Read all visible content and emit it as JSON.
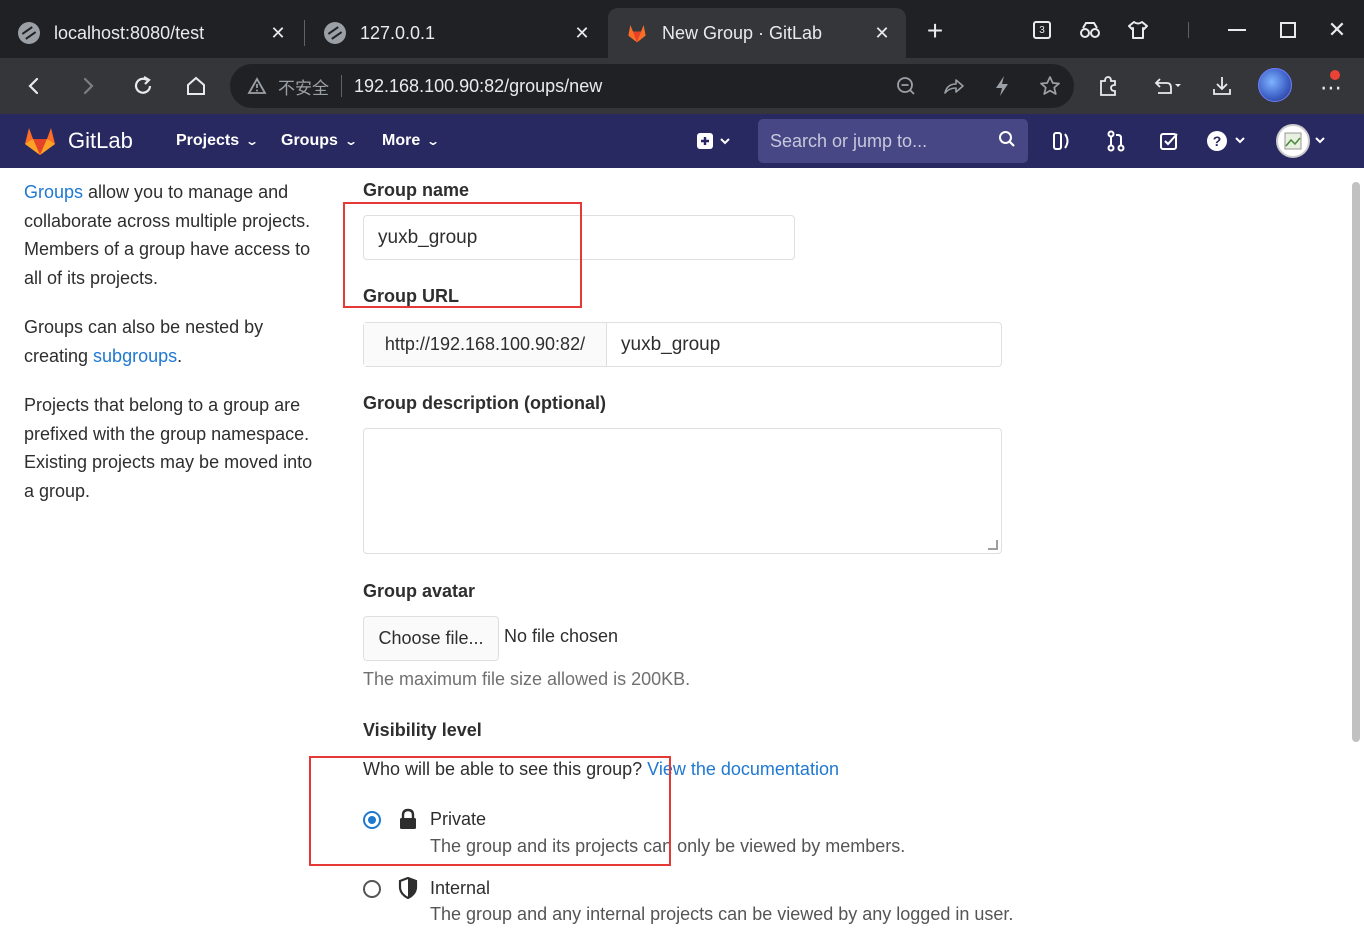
{
  "browser": {
    "tabs": [
      {
        "label": "localhost:8080/test",
        "active": false
      },
      {
        "label": "127.0.0.1",
        "active": false
      },
      {
        "label": "New Group · GitLab",
        "active": true
      }
    ],
    "tab_close": "✕",
    "new_tab": "+",
    "tab_count": "3",
    "insecure_label": "不安全",
    "url": "192.168.100.90:82/groups/new"
  },
  "gitlab": {
    "brand": "GitLab",
    "nav": {
      "projects": "Projects",
      "groups": "Groups",
      "more": "More"
    },
    "search_placeholder": "Search or jump to..."
  },
  "sidebar": {
    "p1_link": "Groups",
    "p1_text": " allow you to manage and collaborate across multiple projects. Members of a group have access to all of its projects.",
    "p2_text": "Groups can also be nested by creating ",
    "p2_link": "subgroups",
    "p2_end": ".",
    "p3_text": "Projects that belong to a group are prefixed with the group namespace. Existing projects may be moved into a group."
  },
  "form": {
    "group_name_label": "Group name",
    "group_name_value": "yuxb_group",
    "group_url_label": "Group URL",
    "group_url_prefix": "http://192.168.100.90:82/",
    "group_url_value": "yuxb_group",
    "description_label": "Group description (optional)",
    "avatar_label": "Group avatar",
    "choose_file": "Choose file...",
    "no_file": "No file chosen",
    "max_size_hint": "The maximum file size allowed is 200KB.",
    "visibility_label": "Visibility level",
    "visibility_question": "Who will be able to see this group? ",
    "visibility_doc_link": "View the documentation",
    "options": [
      {
        "title": "Private",
        "desc": "The group and its projects can only be viewed by members.",
        "checked": true
      },
      {
        "title": "Internal",
        "desc": "The group and any internal projects can be viewed by any logged in user.",
        "checked": false
      }
    ]
  },
  "colors": {
    "gitlab_header": "#292961",
    "link": "#1f78d1",
    "annotation": "#e53935"
  }
}
